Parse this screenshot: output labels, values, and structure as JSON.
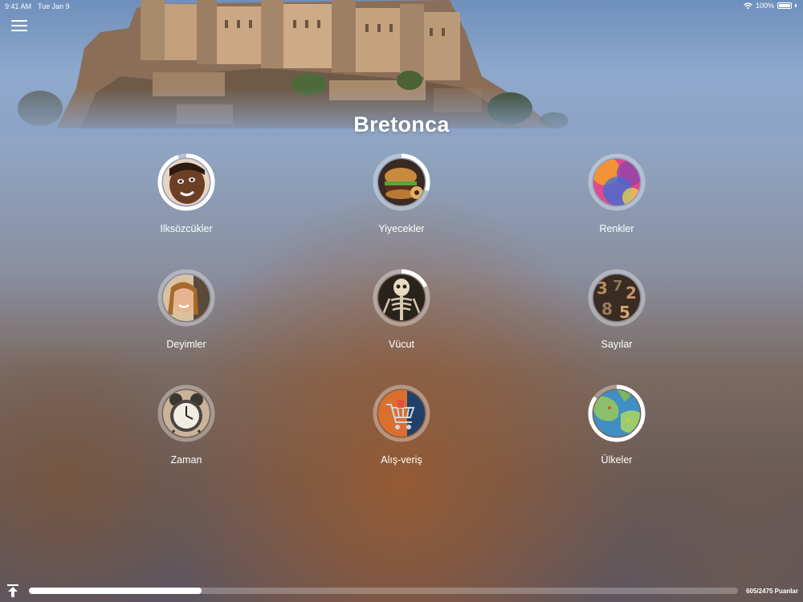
{
  "status": {
    "time": "9:41 AM",
    "date": "Tue Jan 9",
    "battery": "100%"
  },
  "title": "Bretonca",
  "categories": [
    {
      "label": "Ilksözcükler",
      "progress": 0.95,
      "thumb": "child-face-photo"
    },
    {
      "label": "Yiyecekler",
      "progress": 0.3,
      "thumb": "burger-photo"
    },
    {
      "label": "Renkler",
      "progress": 0.0,
      "thumb": "color-powder-photo"
    },
    {
      "label": "Deyimler",
      "progress": 0.0,
      "thumb": "smiling-woman-photo"
    },
    {
      "label": "Vücut",
      "progress": 0.18,
      "thumb": "skeleton-photo"
    },
    {
      "label": "Sayılar",
      "progress": 0.0,
      "thumb": "metal-numbers-photo"
    },
    {
      "label": "Zaman",
      "progress": 0.0,
      "thumb": "alarm-clock-photo"
    },
    {
      "label": "Alış-veriş",
      "progress": 0.0,
      "thumb": "shopping-cart-photo"
    },
    {
      "label": "Ülkeler",
      "progress": 0.85,
      "thumb": "world-map-photo"
    }
  ],
  "footer": {
    "score_text": "605/2475 Puanlar",
    "progress": 0.244
  },
  "icons": {
    "menu": "hamburger-menu-icon",
    "wifi": "wifi-icon",
    "battery": "battery-icon",
    "upload": "upload-top-icon"
  }
}
